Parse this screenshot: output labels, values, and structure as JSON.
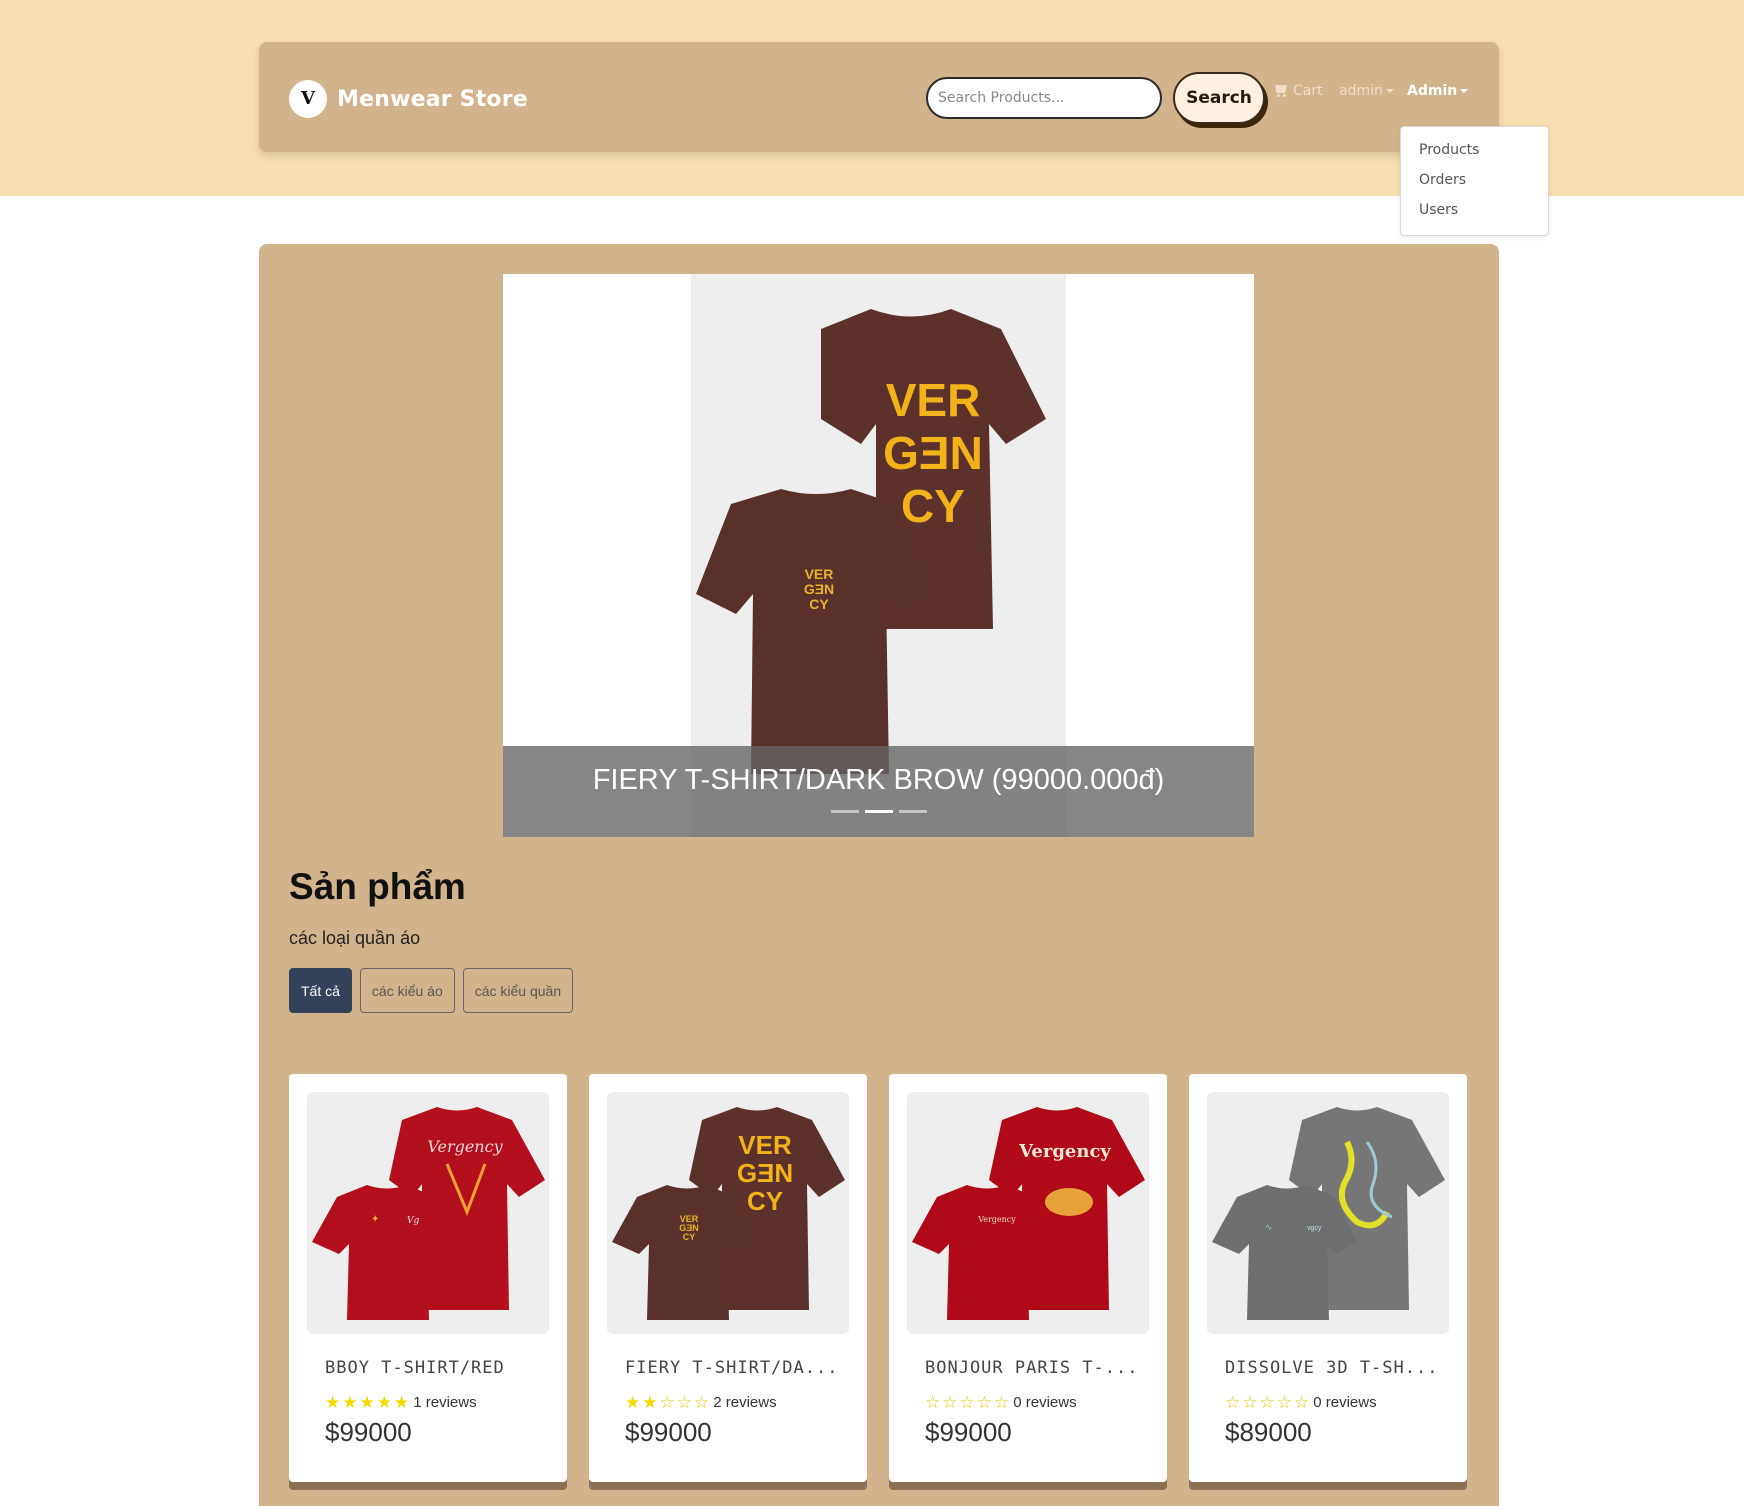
{
  "colors": {
    "page_band": "#f5deb0",
    "panel": "#d2b48c",
    "filter_active": "#34425a",
    "star": "#f5d800"
  },
  "navbar": {
    "brand_logo_letter": "V",
    "brand_name": "Menwear Store",
    "search_placeholder": "Search Products...",
    "search_button": "Search",
    "cart_label": "Cart",
    "user_menu_label": "admin",
    "admin_menu_label": "Admin"
  },
  "admin_dropdown": {
    "items": [
      "Products",
      "Orders",
      "Users"
    ]
  },
  "carousel": {
    "caption": "FIERY T-SHIRT/DARK BROW (99000.000đ)",
    "slide_count": 3,
    "active_index": 1,
    "shirt_color": "#5a302b",
    "print_text": "VERGENCY"
  },
  "products_section": {
    "title": "Sản phẩm",
    "subtitle": "các loại quần áo",
    "filters": [
      "Tất cả",
      "các kiểu áo",
      "các kiểu quần"
    ],
    "active_filter": 0
  },
  "products": [
    {
      "name": "BBOY T-SHIRT/RED",
      "rating": 5,
      "reviews": "1 reviews",
      "price": "$99000",
      "shirt_color": "#b30f1c"
    },
    {
      "name": "FIERY T-SHIRT/DA...",
      "rating": 2,
      "reviews": "2 reviews",
      "price": "$99000",
      "shirt_color": "#5a302b"
    },
    {
      "name": "BONJOUR PARIS T-...",
      "rating": 0,
      "reviews": "0 reviews",
      "price": "$99000",
      "shirt_color": "#b00a18"
    },
    {
      "name": "DISSOLVE 3D T-SH...",
      "rating": 0,
      "reviews": "0 reviews",
      "price": "$89000",
      "shirt_color": "#6f6f6f"
    }
  ]
}
